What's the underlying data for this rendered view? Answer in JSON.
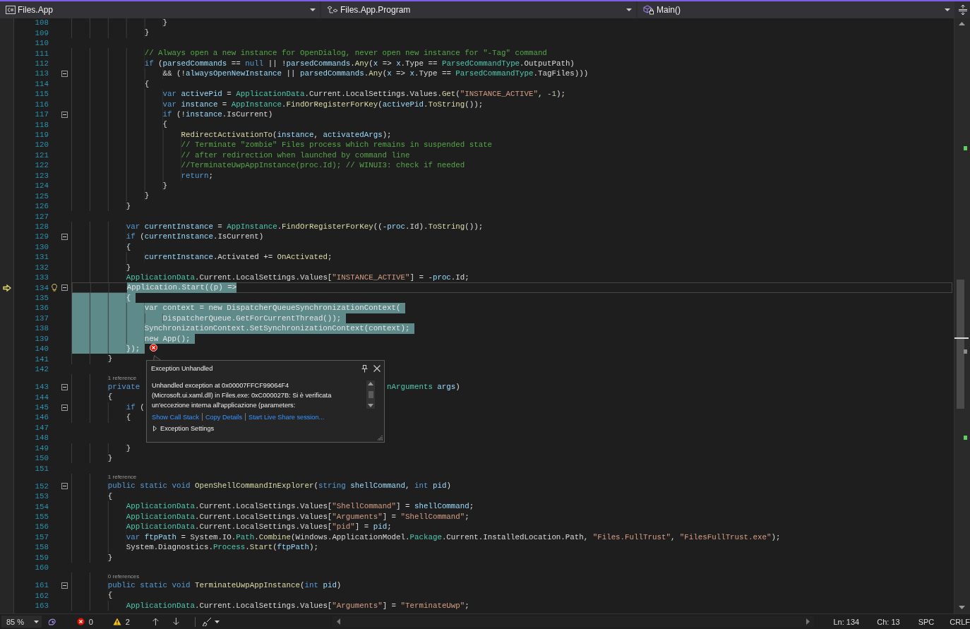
{
  "navigation_bar": {
    "project": "Files.App",
    "type": "Files.App.Program",
    "member": "Main()"
  },
  "editor": {
    "lines": [
      {
        "kind": "code",
        "number": "108",
        "tokens": [
          {
            "text": "                    }",
            "kind": "plain"
          }
        ],
        "foldable": false,
        "selected": false,
        "current": false
      },
      {
        "kind": "code",
        "number": "109",
        "tokens": [
          {
            "text": "                }",
            "kind": "plain"
          }
        ],
        "foldable": false,
        "selected": false,
        "current": false
      },
      {
        "kind": "code",
        "number": "110",
        "foldable": false,
        "selected": false,
        "current": false
      },
      {
        "kind": "code",
        "number": "111",
        "tokens": [
          {
            "text": "                // Always open a new instance for OpenDialog, never open new instance for \"-Tag\" command",
            "kind": "comment"
          }
        ],
        "foldable": false,
        "selected": false,
        "current": false
      },
      {
        "kind": "code",
        "number": "112",
        "tokens": [
          {
            "text": "                if",
            "kind": "keyword"
          },
          {
            "text": " (",
            "kind": "plain"
          },
          {
            "text": "parsedCommands",
            "kind": "local"
          },
          {
            "text": " == ",
            "kind": "plain"
          },
          {
            "text": "null",
            "kind": "keyword"
          },
          {
            "text": " || !",
            "kind": "plain"
          },
          {
            "text": "parsedCommands",
            "kind": "local"
          },
          {
            "text": ".",
            "kind": "plain"
          },
          {
            "text": "Any",
            "kind": "method"
          },
          {
            "text": "(",
            "kind": "plain"
          },
          {
            "text": "x",
            "kind": "local"
          },
          {
            "text": " => ",
            "kind": "plain"
          },
          {
            "text": "x",
            "kind": "local"
          },
          {
            "text": ".Type == ",
            "kind": "plain"
          },
          {
            "text": "ParsedCommandType",
            "kind": "type"
          },
          {
            "text": ".OutputPath)",
            "kind": "plain"
          }
        ],
        "foldable": false,
        "selected": false,
        "current": false
      },
      {
        "kind": "code",
        "number": "113",
        "tokens": [
          {
            "text": "                    && (!",
            "kind": "plain"
          },
          {
            "text": "alwaysOpenNewInstance",
            "kind": "local"
          },
          {
            "text": " || ",
            "kind": "plain"
          },
          {
            "text": "parsedCommands",
            "kind": "local"
          },
          {
            "text": ".",
            "kind": "plain"
          },
          {
            "text": "Any",
            "kind": "method"
          },
          {
            "text": "(",
            "kind": "plain"
          },
          {
            "text": "x",
            "kind": "local"
          },
          {
            "text": " => ",
            "kind": "plain"
          },
          {
            "text": "x",
            "kind": "local"
          },
          {
            "text": ".Type == ",
            "kind": "plain"
          },
          {
            "text": "ParsedCommandType",
            "kind": "type"
          },
          {
            "text": ".TagFiles)))",
            "kind": "plain"
          }
        ],
        "foldable": true,
        "selected": false,
        "current": false
      },
      {
        "kind": "code",
        "number": "114",
        "tokens": [
          {
            "text": "                {",
            "kind": "plain"
          }
        ],
        "foldable": false,
        "selected": false,
        "current": false
      },
      {
        "kind": "code",
        "number": "115",
        "tokens": [
          {
            "text": "                    var",
            "kind": "keyword"
          },
          {
            "text": " activePid",
            "kind": "local"
          },
          {
            "text": " = ",
            "kind": "plain"
          },
          {
            "text": "ApplicationData",
            "kind": "type"
          },
          {
            "text": ".Current.LocalSettings.Values.",
            "kind": "plain"
          },
          {
            "text": "Get",
            "kind": "method"
          },
          {
            "text": "(",
            "kind": "plain"
          },
          {
            "text": "\"INSTANCE_ACTIVE\"",
            "kind": "string"
          },
          {
            "text": ", ",
            "kind": "plain"
          },
          {
            "text": "-1",
            "kind": "number"
          },
          {
            "text": ");",
            "kind": "plain"
          }
        ],
        "foldable": false,
        "selected": false,
        "current": false
      },
      {
        "kind": "code",
        "number": "116",
        "tokens": [
          {
            "text": "                    var",
            "kind": "keyword"
          },
          {
            "text": " instance",
            "kind": "local"
          },
          {
            "text": " = ",
            "kind": "plain"
          },
          {
            "text": "AppInstance",
            "kind": "type"
          },
          {
            "text": ".",
            "kind": "plain"
          },
          {
            "text": "FindOrRegisterForKey",
            "kind": "method"
          },
          {
            "text": "(",
            "kind": "plain"
          },
          {
            "text": "activePid",
            "kind": "local"
          },
          {
            "text": ".",
            "kind": "plain"
          },
          {
            "text": "ToString",
            "kind": "method"
          },
          {
            "text": "());",
            "kind": "plain"
          }
        ],
        "foldable": false,
        "selected": false,
        "current": false
      },
      {
        "kind": "code",
        "number": "117",
        "tokens": [
          {
            "text": "                    if",
            "kind": "keyword"
          },
          {
            "text": " (!",
            "kind": "plain"
          },
          {
            "text": "instance",
            "kind": "local"
          },
          {
            "text": ".IsCurrent)",
            "kind": "plain"
          }
        ],
        "foldable": true,
        "selected": false,
        "current": false
      },
      {
        "kind": "code",
        "number": "118",
        "tokens": [
          {
            "text": "                    {",
            "kind": "plain"
          }
        ],
        "foldable": false,
        "selected": false,
        "current": false
      },
      {
        "kind": "code",
        "number": "119",
        "tokens": [
          {
            "text": "                        RedirectActivationTo",
            "kind": "method"
          },
          {
            "text": "(",
            "kind": "plain"
          },
          {
            "text": "instance",
            "kind": "local"
          },
          {
            "text": ", ",
            "kind": "plain"
          },
          {
            "text": "activatedArgs",
            "kind": "local"
          },
          {
            "text": ");",
            "kind": "plain"
          }
        ],
        "foldable": false,
        "selected": false,
        "current": false
      },
      {
        "kind": "code",
        "number": "120",
        "tokens": [
          {
            "text": "                        // Terminate \"zombie\" Files process which remains in suspended state",
            "kind": "comment"
          }
        ],
        "foldable": false,
        "selected": false,
        "current": false
      },
      {
        "kind": "code",
        "number": "121",
        "tokens": [
          {
            "text": "                        // after redirection when launched by command line",
            "kind": "comment"
          }
        ],
        "foldable": false,
        "selected": false,
        "current": false
      },
      {
        "kind": "code",
        "number": "122",
        "tokens": [
          {
            "text": "                        //TerminateUwpAppInstance(proc.Id); // WINUI3: check if needed",
            "kind": "comment"
          }
        ],
        "foldable": false,
        "selected": false,
        "current": false
      },
      {
        "kind": "code",
        "number": "123",
        "tokens": [
          {
            "text": "                        return",
            "kind": "keyword"
          },
          {
            "text": ";",
            "kind": "plain"
          }
        ],
        "foldable": false,
        "selected": false,
        "current": false
      },
      {
        "kind": "code",
        "number": "124",
        "tokens": [
          {
            "text": "                    }",
            "kind": "plain"
          }
        ],
        "foldable": false,
        "selected": false,
        "current": false
      },
      {
        "kind": "code",
        "number": "125",
        "tokens": [
          {
            "text": "                }",
            "kind": "plain"
          }
        ],
        "foldable": false,
        "selected": false,
        "current": false
      },
      {
        "kind": "code",
        "number": "126",
        "tokens": [
          {
            "text": "            }",
            "kind": "plain"
          }
        ],
        "foldable": false,
        "selected": false,
        "current": false
      },
      {
        "kind": "code",
        "number": "127",
        "foldable": false,
        "selected": false,
        "current": false
      },
      {
        "kind": "code",
        "number": "128",
        "tokens": [
          {
            "text": "            var",
            "kind": "keyword"
          },
          {
            "text": " currentInstance",
            "kind": "local"
          },
          {
            "text": " = ",
            "kind": "plain"
          },
          {
            "text": "AppInstance",
            "kind": "type"
          },
          {
            "text": ".",
            "kind": "plain"
          },
          {
            "text": "FindOrRegisterForKey",
            "kind": "method"
          },
          {
            "text": "((-",
            "kind": "plain"
          },
          {
            "text": "proc",
            "kind": "local"
          },
          {
            "text": ".Id).",
            "kind": "plain"
          },
          {
            "text": "ToString",
            "kind": "method"
          },
          {
            "text": "());",
            "kind": "plain"
          }
        ],
        "foldable": false,
        "selected": false,
        "current": false
      },
      {
        "kind": "code",
        "number": "129",
        "tokens": [
          {
            "text": "            if",
            "kind": "keyword"
          },
          {
            "text": " (",
            "kind": "plain"
          },
          {
            "text": "currentInstance",
            "kind": "local"
          },
          {
            "text": ".IsCurrent)",
            "kind": "plain"
          }
        ],
        "foldable": true,
        "selected": false,
        "current": false
      },
      {
        "kind": "code",
        "number": "130",
        "tokens": [
          {
            "text": "            {",
            "kind": "plain"
          }
        ],
        "foldable": false,
        "selected": false,
        "current": false
      },
      {
        "kind": "code",
        "number": "131",
        "tokens": [
          {
            "text": "                currentInstance",
            "kind": "local"
          },
          {
            "text": ".Activated += ",
            "kind": "plain"
          },
          {
            "text": "OnActivated",
            "kind": "method"
          },
          {
            "text": ";",
            "kind": "plain"
          }
        ],
        "foldable": false,
        "selected": false,
        "current": false
      },
      {
        "kind": "code",
        "number": "132",
        "tokens": [
          {
            "text": "            }",
            "kind": "plain"
          }
        ],
        "foldable": false,
        "selected": false,
        "current": false
      },
      {
        "kind": "code",
        "number": "133",
        "tokens": [
          {
            "text": "            ApplicationData",
            "kind": "type"
          },
          {
            "text": ".Current.LocalSettings.Values[",
            "kind": "plain"
          },
          {
            "text": "\"INSTANCE_ACTIVE\"",
            "kind": "string"
          },
          {
            "text": "] = -",
            "kind": "plain"
          },
          {
            "text": "proc",
            "kind": "local"
          },
          {
            "text": ".Id;",
            "kind": "plain"
          }
        ],
        "foldable": false,
        "selected": false,
        "current": false
      },
      {
        "kind": "code",
        "number": "134",
        "tokens": [
          {
            "text": "            Application.Start((p) =>",
            "kind": "plain"
          }
        ],
        "foldable": true,
        "selected": true,
        "current": true
      },
      {
        "kind": "code",
        "number": "135",
        "tokens": [
          {
            "text": "            {",
            "kind": "plain"
          }
        ],
        "foldable": false,
        "selected": true,
        "current": false
      },
      {
        "kind": "code",
        "number": "136",
        "tokens": [
          {
            "text": "                var context = new DispatcherQueueSynchronizationContext(",
            "kind": "plain"
          }
        ],
        "foldable": false,
        "selected": true,
        "current": false
      },
      {
        "kind": "code",
        "number": "137",
        "tokens": [
          {
            "text": "                    DispatcherQueue.GetForCurrentThread());",
            "kind": "plain"
          }
        ],
        "foldable": false,
        "selected": true,
        "current": false
      },
      {
        "kind": "code",
        "number": "138",
        "tokens": [
          {
            "text": "                SynchronizationContext.SetSynchronizationContext(context);",
            "kind": "plain"
          }
        ],
        "foldable": false,
        "selected": true,
        "current": false
      },
      {
        "kind": "code",
        "number": "139",
        "tokens": [
          {
            "text": "                new App();",
            "kind": "plain"
          }
        ],
        "foldable": false,
        "selected": true,
        "current": false
      },
      {
        "kind": "code",
        "number": "140",
        "tokens": [
          {
            "text": "            });",
            "kind": "plain"
          }
        ],
        "foldable": false,
        "selected": true,
        "current": false
      },
      {
        "kind": "code",
        "number": "141",
        "tokens": [
          {
            "text": "        }",
            "kind": "plain"
          }
        ],
        "foldable": false,
        "selected": false,
        "current": false
      },
      {
        "kind": "code",
        "number": "142",
        "foldable": false,
        "selected": false,
        "current": false
      },
      {
        "kind": "codelens",
        "text": "        1 reference"
      },
      {
        "kind": "code",
        "number": "143",
        "tokens": [
          {
            "text": "        private",
            "kind": "keyword"
          }
        ],
        "tail": [
          {
            "text": "nArguments",
            "kind": "type"
          },
          {
            "text": " args",
            "kind": "local"
          },
          {
            "text": ")",
            "kind": "plain"
          }
        ],
        "foldable": true,
        "selected": false,
        "current": false
      },
      {
        "kind": "code",
        "number": "144",
        "tokens": [
          {
            "text": "        {",
            "kind": "plain"
          }
        ],
        "foldable": false,
        "selected": false,
        "current": false
      },
      {
        "kind": "code",
        "number": "145",
        "tokens": [
          {
            "text": "            if",
            "kind": "keyword"
          },
          {
            "text": " (",
            "kind": "plain"
          }
        ],
        "foldable": true,
        "selected": false,
        "current": false
      },
      {
        "kind": "code",
        "number": "146",
        "tokens": [
          {
            "text": "            {",
            "kind": "plain"
          }
        ],
        "foldable": false,
        "selected": false,
        "current": false
      },
      {
        "kind": "code",
        "number": "147",
        "foldable": false,
        "selected": false,
        "current": false
      },
      {
        "kind": "code",
        "number": "148",
        "foldable": false,
        "selected": false,
        "current": false
      },
      {
        "kind": "code",
        "number": "149",
        "tokens": [
          {
            "text": "            }",
            "kind": "plain"
          }
        ],
        "foldable": false,
        "selected": false,
        "current": false
      },
      {
        "kind": "code",
        "number": "150",
        "tokens": [
          {
            "text": "        }",
            "kind": "plain"
          }
        ],
        "foldable": false,
        "selected": false,
        "current": false
      },
      {
        "kind": "code",
        "number": "151",
        "foldable": false,
        "selected": false,
        "current": false
      },
      {
        "kind": "codelens",
        "text": "        1 reference"
      },
      {
        "kind": "code",
        "number": "152",
        "tokens": [
          {
            "text": "        public static void",
            "kind": "keyword"
          },
          {
            "text": " OpenShellCommandInExplorer",
            "kind": "method"
          },
          {
            "text": "(",
            "kind": "plain"
          },
          {
            "text": "string",
            "kind": "keyword"
          },
          {
            "text": " shellCommand",
            "kind": "local"
          },
          {
            "text": ", ",
            "kind": "plain"
          },
          {
            "text": "int",
            "kind": "keyword"
          },
          {
            "text": " pid",
            "kind": "local"
          },
          {
            "text": ")",
            "kind": "plain"
          }
        ],
        "foldable": true,
        "selected": false,
        "current": false
      },
      {
        "kind": "code",
        "number": "153",
        "tokens": [
          {
            "text": "        {",
            "kind": "plain"
          }
        ],
        "foldable": false,
        "selected": false,
        "current": false
      },
      {
        "kind": "code",
        "number": "154",
        "tokens": [
          {
            "text": "            ApplicationData",
            "kind": "type"
          },
          {
            "text": ".Current.LocalSettings.Values[",
            "kind": "plain"
          },
          {
            "text": "\"ShellCommand\"",
            "kind": "string"
          },
          {
            "text": "] = ",
            "kind": "plain"
          },
          {
            "text": "shellCommand",
            "kind": "local"
          },
          {
            "text": ";",
            "kind": "plain"
          }
        ],
        "foldable": false,
        "selected": false,
        "current": false
      },
      {
        "kind": "code",
        "number": "155",
        "tokens": [
          {
            "text": "            ApplicationData",
            "kind": "type"
          },
          {
            "text": ".Current.LocalSettings.Values[",
            "kind": "plain"
          },
          {
            "text": "\"Arguments\"",
            "kind": "string"
          },
          {
            "text": "] = ",
            "kind": "plain"
          },
          {
            "text": "\"ShellCommand\"",
            "kind": "string"
          },
          {
            "text": ";",
            "kind": "plain"
          }
        ],
        "foldable": false,
        "selected": false,
        "current": false
      },
      {
        "kind": "code",
        "number": "156",
        "tokens": [
          {
            "text": "            ApplicationData",
            "kind": "type"
          },
          {
            "text": ".Current.LocalSettings.Values[",
            "kind": "plain"
          },
          {
            "text": "\"pid\"",
            "kind": "string"
          },
          {
            "text": "] = ",
            "kind": "plain"
          },
          {
            "text": "pid",
            "kind": "local"
          },
          {
            "text": ";",
            "kind": "plain"
          }
        ],
        "foldable": false,
        "selected": false,
        "current": false
      },
      {
        "kind": "code",
        "number": "157",
        "tokens": [
          {
            "text": "            var",
            "kind": "keyword"
          },
          {
            "text": " ftpPath",
            "kind": "local"
          },
          {
            "text": " = System.IO.",
            "kind": "plain"
          },
          {
            "text": "Path",
            "kind": "type"
          },
          {
            "text": ".",
            "kind": "plain"
          },
          {
            "text": "Combine",
            "kind": "method"
          },
          {
            "text": "(Windows.ApplicationModel.",
            "kind": "plain"
          },
          {
            "text": "Package",
            "kind": "type"
          },
          {
            "text": ".Current.InstalledLocation.Path, ",
            "kind": "plain"
          },
          {
            "text": "\"Files.FullTrust\"",
            "kind": "string"
          },
          {
            "text": ", ",
            "kind": "plain"
          },
          {
            "text": "\"FilesFullTrust.exe\"",
            "kind": "string"
          },
          {
            "text": ");",
            "kind": "plain"
          }
        ],
        "foldable": false,
        "selected": false,
        "current": false
      },
      {
        "kind": "code",
        "number": "158",
        "tokens": [
          {
            "text": "            System.Diagnostics.",
            "kind": "plain"
          },
          {
            "text": "Process",
            "kind": "type"
          },
          {
            "text": ".",
            "kind": "plain"
          },
          {
            "text": "Start",
            "kind": "method"
          },
          {
            "text": "(",
            "kind": "plain"
          },
          {
            "text": "ftpPath",
            "kind": "local"
          },
          {
            "text": ");",
            "kind": "plain"
          }
        ],
        "foldable": false,
        "selected": false,
        "current": false
      },
      {
        "kind": "code",
        "number": "159",
        "tokens": [
          {
            "text": "        }",
            "kind": "plain"
          }
        ],
        "foldable": false,
        "selected": false,
        "current": false
      },
      {
        "kind": "code",
        "number": "160",
        "foldable": false,
        "selected": false,
        "current": false
      },
      {
        "kind": "codelens",
        "text": "        0 references"
      },
      {
        "kind": "code",
        "number": "161",
        "tokens": [
          {
            "text": "        public static void",
            "kind": "keyword"
          },
          {
            "text": " TerminateUwpAppInstance",
            "kind": "method"
          },
          {
            "text": "(",
            "kind": "plain"
          },
          {
            "text": "int",
            "kind": "keyword"
          },
          {
            "text": " pid",
            "kind": "local"
          },
          {
            "text": ")",
            "kind": "plain"
          }
        ],
        "foldable": true,
        "selected": false,
        "current": false
      },
      {
        "kind": "code",
        "number": "162",
        "tokens": [
          {
            "text": "        {",
            "kind": "plain"
          }
        ],
        "foldable": false,
        "selected": false,
        "current": false
      },
      {
        "kind": "code",
        "number": "163",
        "tokens": [
          {
            "text": "            ApplicationData",
            "kind": "type"
          },
          {
            "text": ".Current.LocalSettings.Values[",
            "kind": "plain"
          },
          {
            "text": "\"Arguments\"",
            "kind": "string"
          },
          {
            "text": "] = ",
            "kind": "plain"
          },
          {
            "text": "\"TerminateUwp\"",
            "kind": "string"
          },
          {
            "text": ";",
            "kind": "plain"
          }
        ],
        "foldable": false,
        "selected": false,
        "current": false
      }
    ]
  },
  "exception_popup": {
    "title": "Exception Unhandled",
    "message": "Unhandled exception at 0x00007FFCF99064F4 (Microsoft.ui.xaml.dll) in Files.exe: 0xC000027B: Si è verificata un'eccezione interna all'applicazione (parameters:",
    "links": [
      "Show Call Stack",
      "Copy Details",
      "Start Live Share session..."
    ],
    "settings": {
      "label": "Exception Settings",
      "expanded": false
    }
  },
  "status_bar": {
    "zoom": "85 %",
    "errors": "0",
    "warnings": "2",
    "line": "Ln: 134",
    "column": "Ch: 13",
    "indentation": "SPC",
    "line_endings": "CRLF"
  }
}
